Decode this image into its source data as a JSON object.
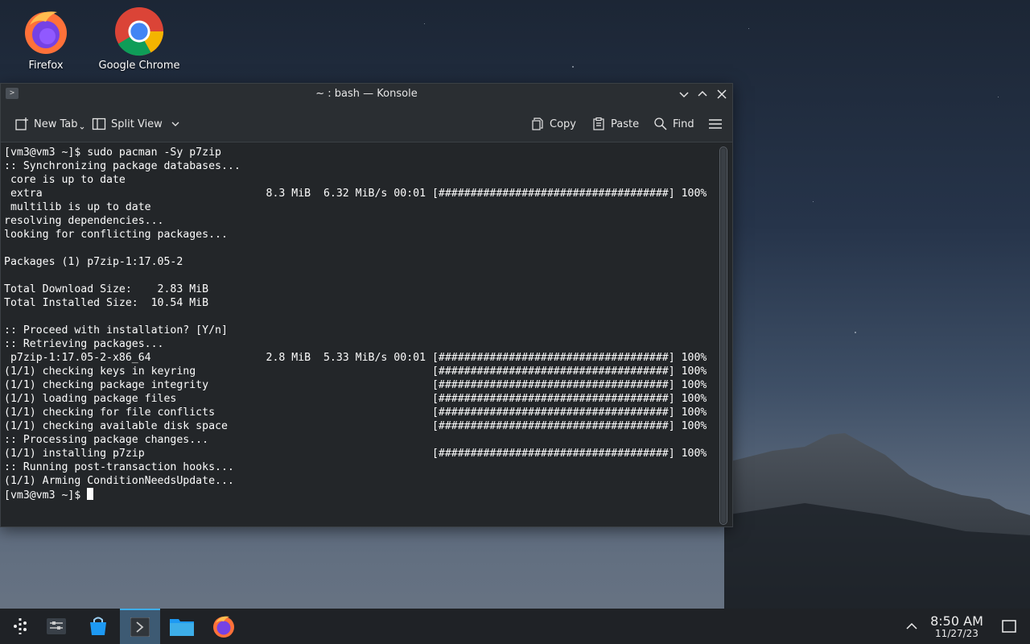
{
  "desktop": {
    "icons": [
      {
        "label": "Firefox"
      },
      {
        "label": "Google Chrome"
      }
    ]
  },
  "window": {
    "title": "~ : bash — Konsole",
    "toolbar": {
      "new_tab": "New Tab",
      "split_view": "Split View",
      "copy": "Copy",
      "paste": "Paste",
      "find": "Find"
    }
  },
  "terminal": {
    "lines": [
      "[vm3@vm3 ~]$ sudo pacman -Sy p7zip",
      ":: Synchronizing package databases...",
      " core is up to date",
      " extra                                   8.3 MiB  6.32 MiB/s 00:01 [####################################] 100%",
      " multilib is up to date",
      "resolving dependencies...",
      "looking for conflicting packages...",
      "",
      "Packages (1) p7zip-1:17.05-2",
      "",
      "Total Download Size:    2.83 MiB",
      "Total Installed Size:  10.54 MiB",
      "",
      ":: Proceed with installation? [Y/n]",
      ":: Retrieving packages...",
      " p7zip-1:17.05-2-x86_64                  2.8 MiB  5.33 MiB/s 00:01 [####################################] 100%",
      "(1/1) checking keys in keyring                                     [####################################] 100%",
      "(1/1) checking package integrity                                   [####################################] 100%",
      "(1/1) loading package files                                        [####################################] 100%",
      "(1/1) checking for file conflicts                                  [####################################] 100%",
      "(1/1) checking available disk space                                [####################################] 100%",
      ":: Processing package changes...",
      "(1/1) installing p7zip                                             [####################################] 100%",
      ":: Running post-transaction hooks...",
      "(1/1) Arming ConditionNeedsUpdate..."
    ],
    "prompt": "[vm3@vm3 ~]$ "
  },
  "taskbar": {
    "time": "8:50 AM",
    "date": "11/27/23"
  },
  "colors": {
    "accent": "#3daee9",
    "terminal_bg": "#232629",
    "terminal_fg": "#fcfcfc"
  }
}
